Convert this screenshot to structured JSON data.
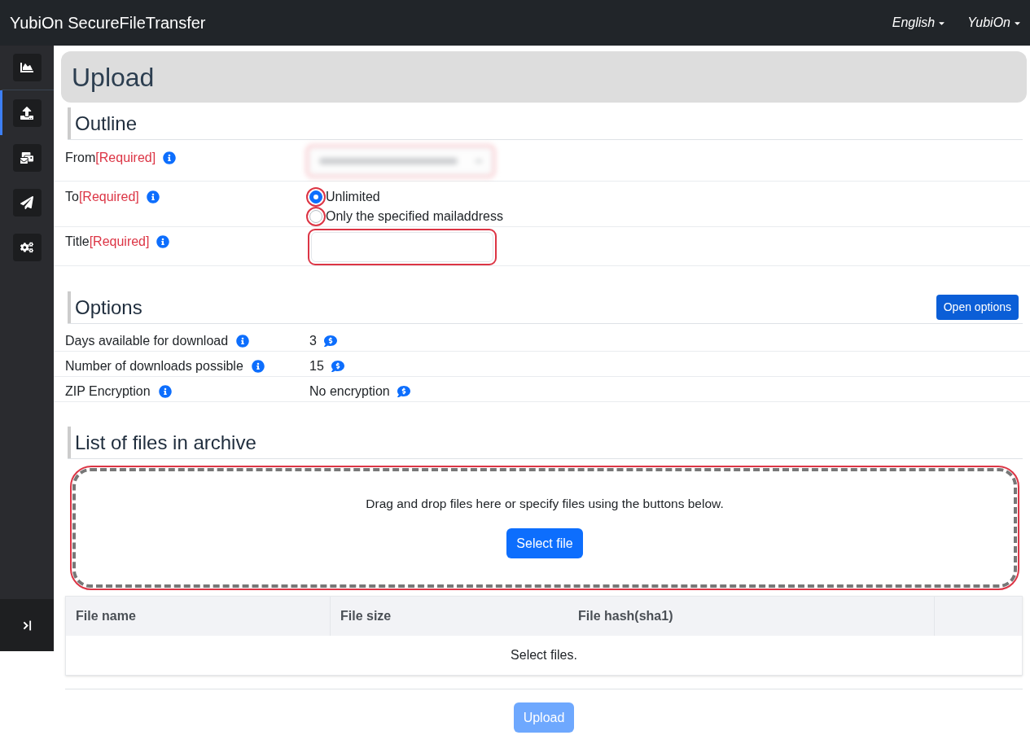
{
  "navbar": {
    "title": "YubiOn SecureFileTransfer",
    "menus": [
      {
        "label": "English"
      },
      {
        "label": "YubiOn"
      }
    ]
  },
  "sidebar": {
    "items": [
      {
        "selected": false
      },
      {
        "selected": true
      },
      {
        "selected": false
      },
      {
        "selected": false
      },
      {
        "selected": false
      }
    ]
  },
  "page_header": {
    "title": "Upload"
  },
  "outline": {
    "heading": "Outline",
    "rows": [
      {
        "kind": "select",
        "label": "From",
        "required": "[Required]",
        "invalid": true,
        "blurred": true
      },
      {
        "kind": "radio",
        "label": "To",
        "required": "[Required]",
        "options": [
          {
            "label": "Unlimited",
            "selected": true,
            "invalid": true
          },
          {
            "label": "Only the specified mailaddress",
            "selected": false,
            "invalid": true
          }
        ]
      },
      {
        "kind": "text",
        "label": "Title",
        "required": "[Required]",
        "invalid": true
      }
    ]
  },
  "options": {
    "heading": "Options",
    "button": "Open options",
    "rows": [
      {
        "label": "Days available for download",
        "value": "3"
      },
      {
        "label": "Number of downloads possible",
        "value": "15"
      },
      {
        "label": "ZIP Encryption",
        "value": "No encryption"
      }
    ]
  },
  "files": {
    "heading": "List of files in archive",
    "dropzone": {
      "text": "Drag and drop files here or specify files using the buttons below.",
      "button": "Select file",
      "invalid": true
    },
    "table": {
      "columns": [
        "File name",
        "File size",
        "File hash(sha1)"
      ],
      "empty_text": "Select files."
    }
  },
  "upload_button": {
    "label": "Upload",
    "disabled": true
  }
}
